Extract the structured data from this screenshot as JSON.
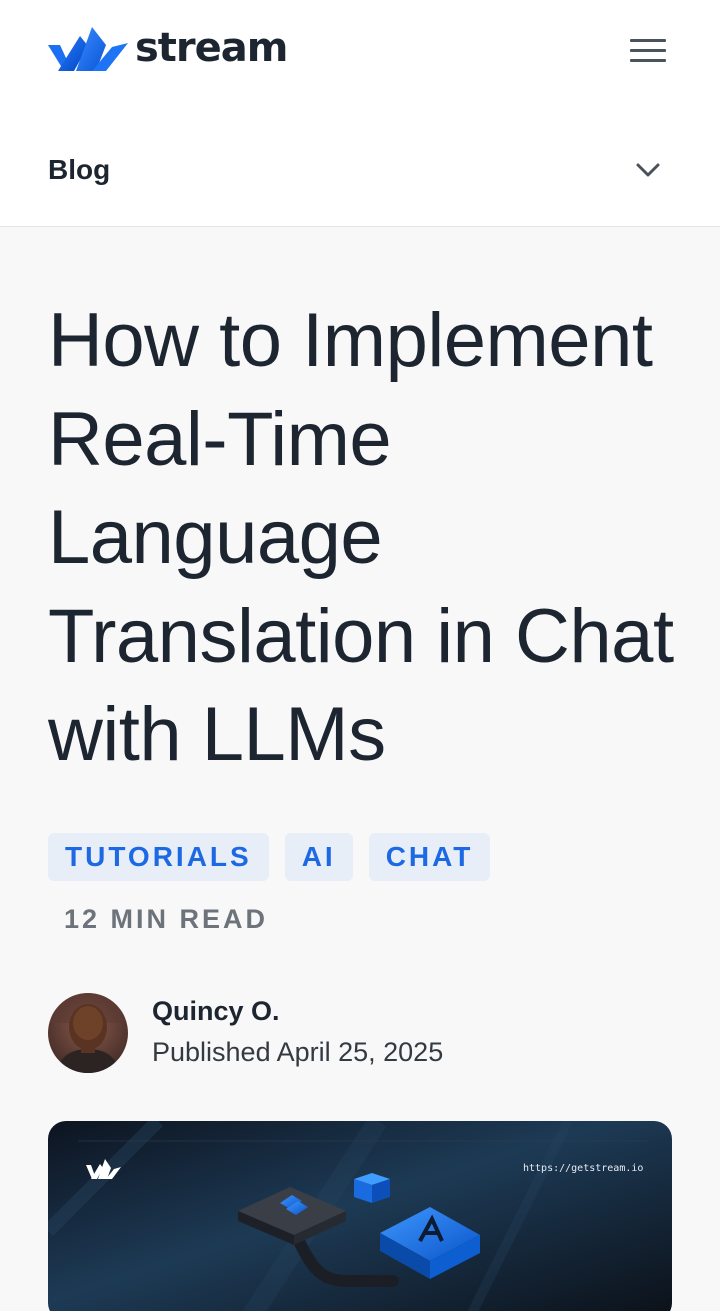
{
  "header": {
    "logo_text": "stream",
    "logo_icon": "stream-logo-icon",
    "menu_icon": "hamburger-menu-icon"
  },
  "nav": {
    "section_label": "Blog",
    "dropdown_icon": "chevron-down-icon"
  },
  "article": {
    "title": "How to Implement Real-Time Language Translation in Chat with LLMs",
    "tags": [
      "TUTORIALS",
      "AI",
      "CHAT"
    ],
    "read_time": "12 MIN READ",
    "author": {
      "name": "Quincy O.",
      "published": "Published April 25, 2025"
    },
    "hero": {
      "url_text": "https://getstream.io"
    }
  },
  "colors": {
    "accent": "#1d69e3",
    "tag_bg": "#e7eef8",
    "text": "#1c2530",
    "page_bg": "#f8f8f9"
  }
}
